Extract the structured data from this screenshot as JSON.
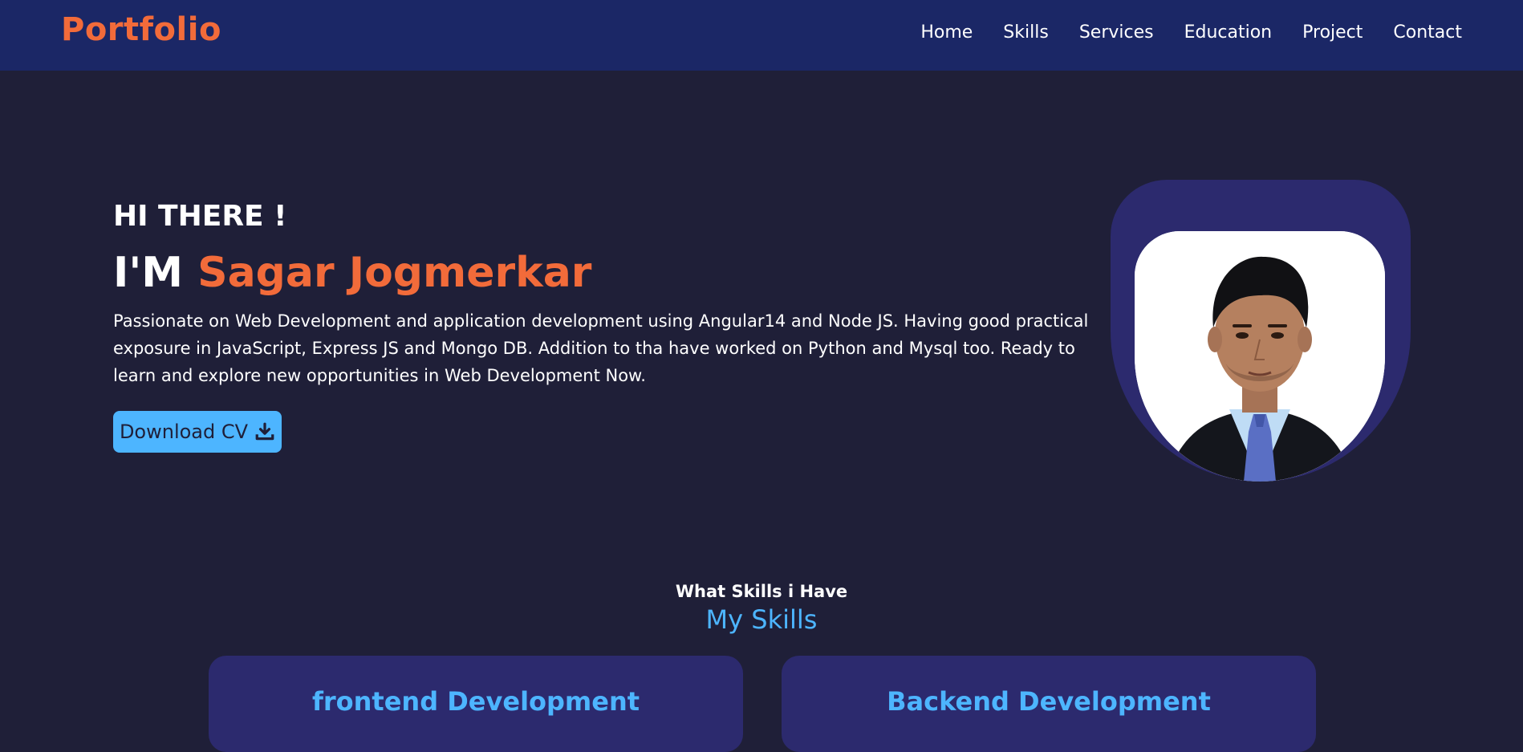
{
  "nav": {
    "brand": "Portfolio",
    "links": [
      "Home",
      "Skills",
      "Services",
      "Education",
      "Project",
      "Contact"
    ]
  },
  "hero": {
    "greeting": "HI THERE !",
    "im_prefix": "I'M",
    "name": "Sagar Jogmerkar",
    "bio": "Passionate on Web Development and application development using Angular14 and Node JS. Having good practical exposure in JavaScript, Express JS and Mongo DB. Addition to tha have worked on Python and Mysql too. Ready to learn and explore new opportunities in Web Development Now.",
    "cv_button": "Download CV",
    "cv_icon": "download-icon"
  },
  "skills": {
    "subtitle": "What Skills i Have",
    "title": "My Skills",
    "cards": [
      "frontend Development",
      "Backend Development"
    ]
  },
  "colors": {
    "navbar": "#1b2766",
    "background": "#1f1f38",
    "accent_orange": "#f26b3a",
    "accent_blue": "#4db5ff",
    "card": "#2c2a6e"
  }
}
